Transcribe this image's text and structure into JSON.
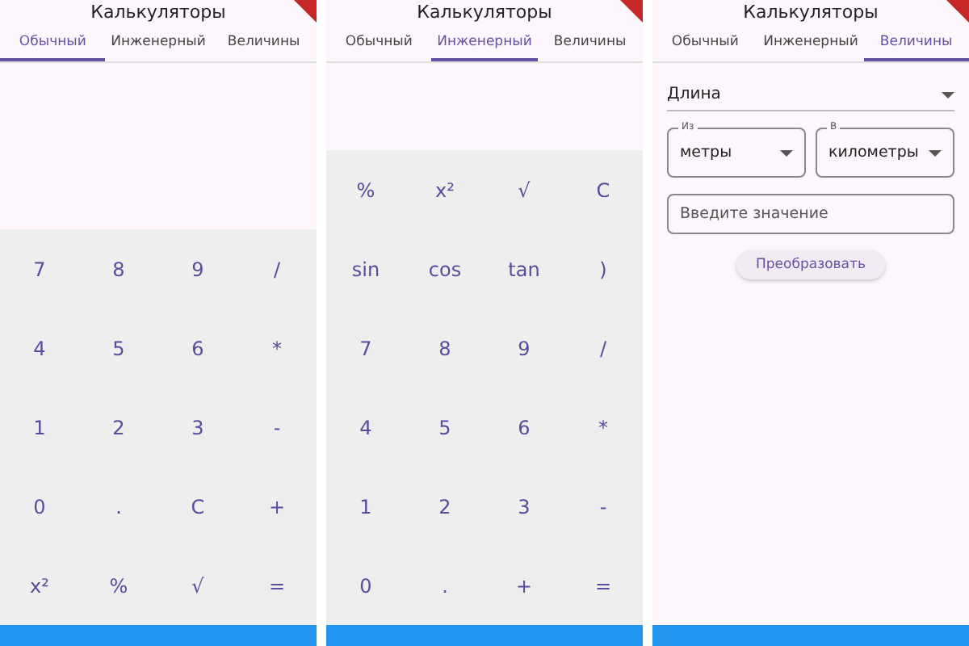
{
  "panels": [
    {
      "kind": "keypad",
      "title": "Калькуляторы",
      "tabs": [
        {
          "label": "Обычный",
          "selected": true
        },
        {
          "label": "Инженерный",
          "selected": false
        },
        {
          "label": "Величины",
          "selected": false
        }
      ],
      "keys": [
        "7",
        "8",
        "9",
        "/",
        "4",
        "5",
        "6",
        "*",
        "1",
        "2",
        "3",
        "-",
        "0",
        ".",
        "C",
        "+",
        "x²",
        "%",
        "√",
        "="
      ]
    },
    {
      "kind": "keypad",
      "title": "Калькуляторы",
      "tabs": [
        {
          "label": "Обычный",
          "selected": false
        },
        {
          "label": "Инженерный",
          "selected": true
        },
        {
          "label": "Величины",
          "selected": false
        }
      ],
      "keys": [
        "%",
        "x²",
        "√",
        "C",
        "sin",
        "cos",
        "tan",
        ")",
        "7",
        "8",
        "9",
        "/",
        "4",
        "5",
        "6",
        "*",
        "1",
        "2",
        "3",
        "-",
        "0",
        ".",
        "+",
        "="
      ]
    },
    {
      "kind": "units",
      "title": "Калькуляторы",
      "tabs": [
        {
          "label": "Обычный",
          "selected": false
        },
        {
          "label": "Инженерный",
          "selected": false
        },
        {
          "label": "Величины",
          "selected": true
        }
      ],
      "category": "Длина",
      "from": {
        "label": "Из",
        "value": "метры"
      },
      "to": {
        "label": "В",
        "value": "километры"
      },
      "input": {
        "placeholder": "Введите значение"
      },
      "button": "Преобразовать"
    }
  ]
}
